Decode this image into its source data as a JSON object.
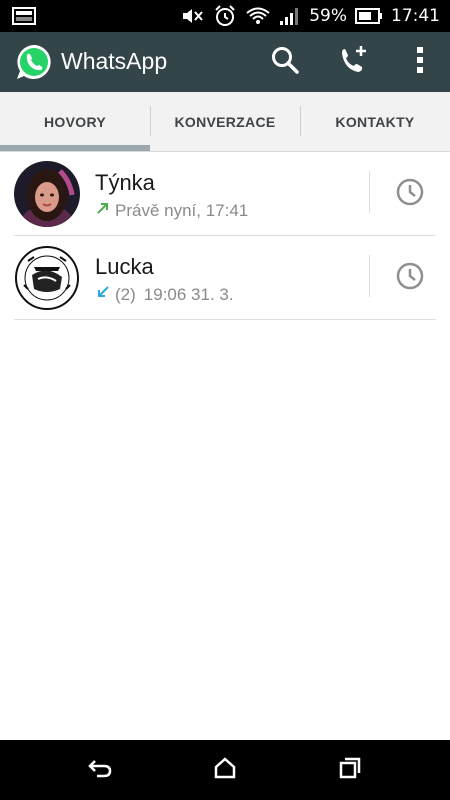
{
  "status_bar": {
    "battery_percent": "59%",
    "time": "17:41",
    "icons": [
      "screenshot-icon",
      "mute-icon",
      "alarm-icon",
      "wifi-icon",
      "signal-icon",
      "battery-icon"
    ]
  },
  "app_bar": {
    "title": "WhatsApp",
    "icons": [
      "whatsapp-logo-icon",
      "search-icon",
      "new-call-icon",
      "overflow-menu-icon"
    ]
  },
  "tabs": [
    {
      "label": "HOVORY",
      "selected": true
    },
    {
      "label": "KONVERZACE",
      "selected": false
    },
    {
      "label": "KONTAKTY",
      "selected": false
    }
  ],
  "calls": [
    {
      "name": "Týnka",
      "direction": "outgoing",
      "count": "",
      "time": "Právě nyní, 17:41",
      "arrow_color": "#4caf50"
    },
    {
      "name": "Lucka",
      "direction": "incoming",
      "count": "(2)",
      "time": "19:06 31. 3.",
      "arrow_color": "#29a9e0"
    }
  ],
  "nav_bar": {
    "icons": [
      "back-icon",
      "home-icon",
      "recent-apps-icon"
    ]
  },
  "colors": {
    "app_bar": "#34454a",
    "tab_indicator": "#9aa7ad",
    "whatsapp_green": "#25d366"
  }
}
